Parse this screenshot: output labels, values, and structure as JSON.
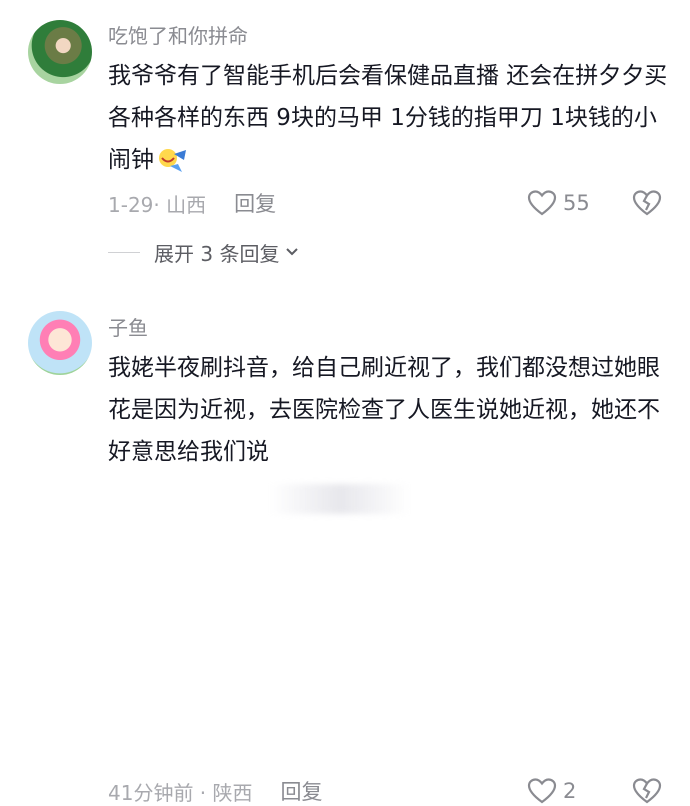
{
  "comments": [
    {
      "username": "吃饱了和你拼命",
      "text": "我爷爷有了智能手机后会看保健品直播 还会在拼夕夕买各种各样的东西 9块的马甲 1分钱的指甲刀 1块钱的小闹钟",
      "emoji": "laughing-sticker",
      "timestamp": "1-29· 山西",
      "reply_label": "回复",
      "like_count": "55",
      "expand_label": "展开 3 条回复"
    },
    {
      "username": "子鱼",
      "text": "我姥半夜刷抖音，给自己刷近视了，我们都没想过她眼花是因为近视，去医院检查了人医生说她近视，她还不好意思给我们说",
      "timestamp": "41分钟前 · 陕西",
      "reply_label": "回复",
      "like_count": "2"
    }
  ],
  "colors": {
    "text": "#161823",
    "secondary": "#8a8b91",
    "meta": "#a8a9ae"
  }
}
